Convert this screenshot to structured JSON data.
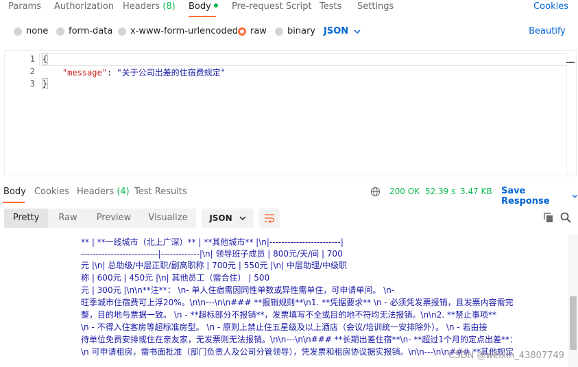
{
  "request_tabs": [
    {
      "label": "Params"
    },
    {
      "label": "Authorization"
    },
    {
      "label": "Headers",
      "count": "(8)"
    },
    {
      "label": "Body"
    },
    {
      "label": "Pre-request Script"
    },
    {
      "label": "Tests"
    },
    {
      "label": "Settings"
    }
  ],
  "cookies_label": "Cookies",
  "body_types": [
    {
      "label": "none",
      "selected": false
    },
    {
      "label": "form-data",
      "selected": false
    },
    {
      "label": "x-www-form-urlencoded",
      "selected": false
    },
    {
      "label": "raw",
      "selected": true
    },
    {
      "label": "binary",
      "selected": false
    }
  ],
  "raw_language": "JSON",
  "beautify_label": "Beautify",
  "editor": {
    "line_numbers": [
      "1",
      "2",
      "3"
    ],
    "lines": {
      "open": "{",
      "key": "\"message\"",
      "colon": ": ",
      "value": "\"关于公司出差的住宿费规定\"",
      "close": "}"
    }
  },
  "response_tabs": [
    {
      "label": "Body"
    },
    {
      "label": "Cookies"
    },
    {
      "label": "Headers",
      "count": "(4)"
    },
    {
      "label": "Test Results"
    }
  ],
  "status": {
    "code": "200 OK",
    "time": "52.39 s",
    "size": "3.47 KB"
  },
  "save_response_label": "Save Response",
  "view_modes": [
    {
      "label": "Pretty",
      "active": true
    },
    {
      "label": "Raw",
      "active": false
    },
    {
      "label": "Preview",
      "active": false
    },
    {
      "label": "Visualize",
      "active": false
    }
  ],
  "response_format": "JSON",
  "response_lines": [
    "**                | **一线城市（北上广深）** | **其他城市** |\\n|------------------------|",
    "--------------------------|-------------|\\n| 领导班子成员              | 800元/天/间           | 700",
    "元        |\\n| 总助级/中层正职/副高职称 | 700元               | 550元        |\\n| 中层助理/中级职",
    "称         | 600元              | 450元        |\\n| 其他员工（需合住）       | 500",
    "元               | 300元         |\\n\\n**注**：  \\n- 单人住宿需因同性单数或异性需单住，可申请单间。  \\n-",
    "旺季城市住宿费可上浮20%。\\n\\n---\\n\\n### **报销规则**\\n1. **凭据要求**  \\n   - 必须凭发票报销，且发票内容需完",
    "整，目的地与票据一致。  \\n   - **超标部分不报销**，发票填写不全或目的地不符均无法报销。\\n\\n2. **禁止事项**",
    "\\n   - 不得入住客房等超标准房型。  \\n   - 原则上禁止住五星级及以上酒店（会议/培训统一安排除外）。  \\n   - 若由接",
    "待单位免费安排或住在亲友家，无发票则无法报销。\\n\\n---\\n\\n### **长期出差住宿**\\n- **超过1个月的定点出差**：",
    "\\n   可申请租房，需书面批准（部门负责人及公司分管领导），凭发票和租房协议据实报销。\\n\\n---\\n\\n### **其他规定"
  ],
  "watermark": "CSDN @weixin_43807749"
}
